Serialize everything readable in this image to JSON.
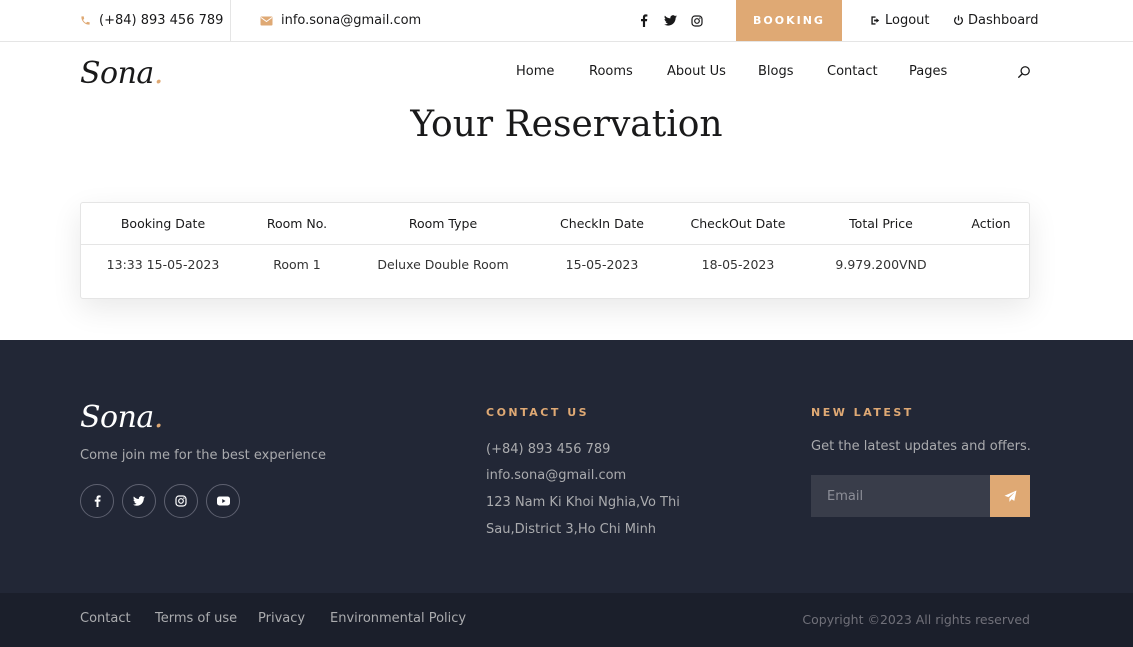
{
  "topbar": {
    "phone": "(+84) 893 456 789",
    "email": "info.sona@gmail.com",
    "socials": [
      "facebook-icon",
      "twitter-icon",
      "instagram-icon"
    ],
    "booking_label": "BOOKING",
    "logout_label": "Logout",
    "dashboard_label": "Dashboard"
  },
  "nav": {
    "logo": "Sona",
    "logo_dot": ".",
    "links": [
      "Home",
      "Rooms",
      "About Us",
      "Blogs",
      "Contact",
      "Pages"
    ],
    "search_icon": "search-icon"
  },
  "main": {
    "title": "Your Reservation",
    "table": {
      "headers": [
        "Booking Date",
        "Room No.",
        "Room Type",
        "CheckIn Date",
        "CheckOut Date",
        "Total Price",
        "Action"
      ],
      "rows": [
        [
          "13:33 15-05-2023",
          "Room 1",
          "Deluxe Double Room",
          "15-05-2023",
          "18-05-2023",
          "9.979.200VND",
          ""
        ]
      ]
    }
  },
  "footer": {
    "logo": "Sona",
    "logo_dot": ".",
    "tagline": "Come join me for the best experience",
    "socials": [
      "facebook-icon",
      "twitter-icon",
      "instagram-icon",
      "youtube-icon"
    ],
    "contact": {
      "heading": "CONTACT US",
      "phone": "(+84) 893 456 789",
      "email": "info.sona@gmail.com",
      "address_line1": "123 Nam Ki Khoi Nghia,Vo Thi",
      "address_line2": "Sau,District 3,Ho Chi Minh"
    },
    "newsletter": {
      "heading": "NEW LATEST",
      "text": "Get the latest updates and offers.",
      "placeholder": "Email"
    },
    "bottom_links": [
      "Contact",
      "Terms of use",
      "Privacy",
      "Environmental Policy"
    ],
    "copyright": "Copyright ©2023 All rights reserved"
  },
  "colors": {
    "accent": "#dfa974",
    "footer_bg": "#222736",
    "footer_bottom_bg": "#1b1f2b",
    "text_dark": "#19191a"
  }
}
